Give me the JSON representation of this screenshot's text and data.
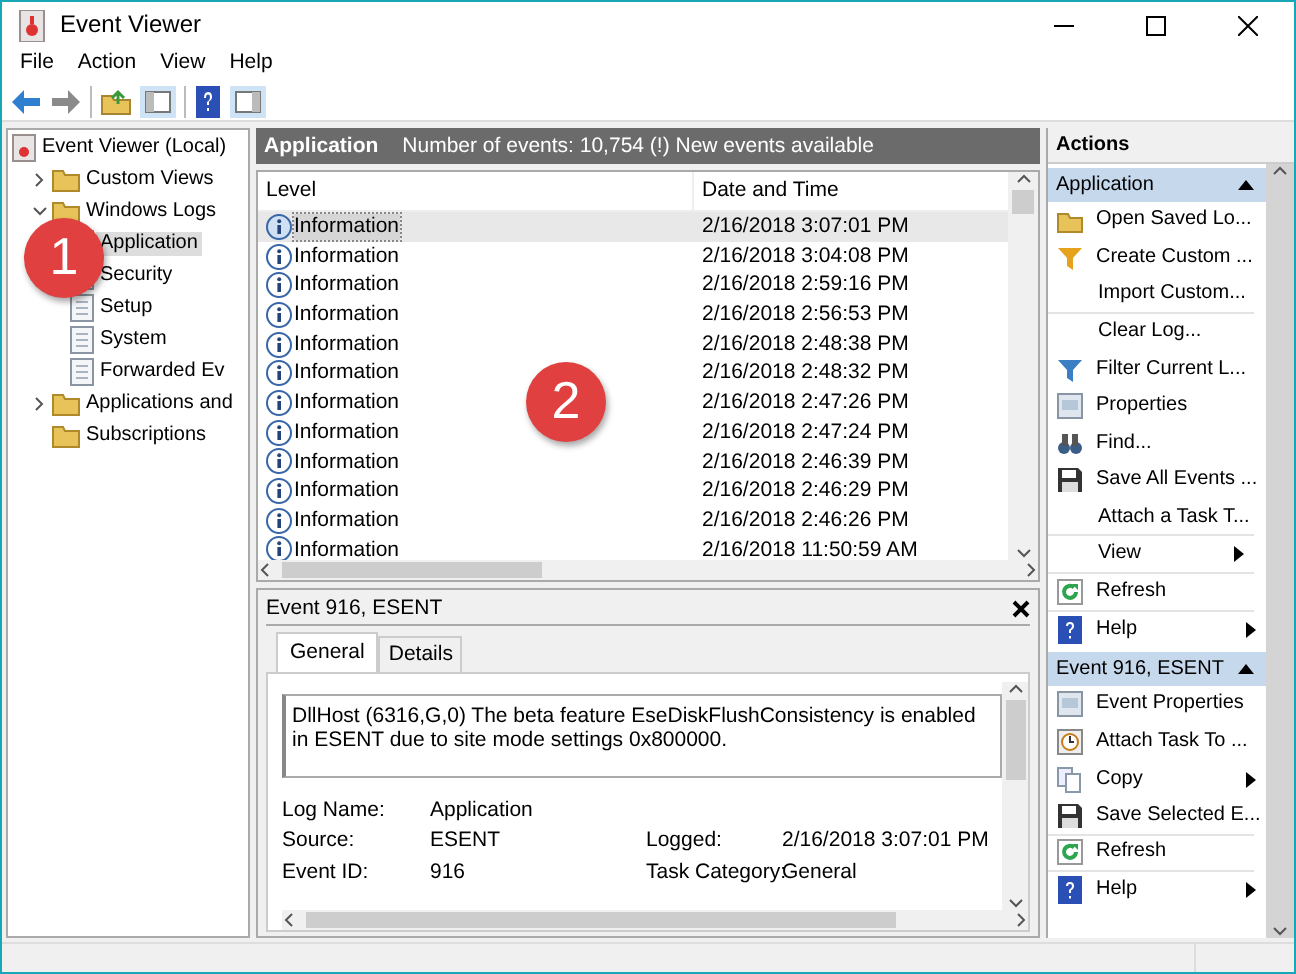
{
  "window": {
    "title": "Event Viewer"
  },
  "menu": [
    "File",
    "Action",
    "View",
    "Help"
  ],
  "tree": {
    "label": "Event Viewer (Local)",
    "selected": false,
    "children": [
      {
        "label": "Custom Views",
        "selected": false,
        "expanded": false
      },
      {
        "label": "Windows Logs",
        "selected": false,
        "expanded": true,
        "children": [
          {
            "label": "Application",
            "selected": true
          },
          {
            "label": "Security",
            "selected": false
          },
          {
            "label": "Setup",
            "selected": false
          },
          {
            "label": "System",
            "selected": false
          },
          {
            "label": "Forwarded Ev",
            "selected": false
          }
        ]
      },
      {
        "label": "Applications and",
        "selected": false,
        "expanded": false
      },
      {
        "label": "Subscriptions",
        "selected": false
      }
    ]
  },
  "events": {
    "title": "Application",
    "summary": "Number of events: 10,754 (!) New events available",
    "columns": [
      "Level",
      "Date and Time"
    ],
    "rows": [
      {
        "level": "Information",
        "date_time": "2/16/2018 3:07:01 PM",
        "selected": true
      },
      {
        "level": "Information",
        "date_time": "2/16/2018 3:04:08 PM",
        "selected": false
      },
      {
        "level": "Information",
        "date_time": "2/16/2018 2:59:16 PM",
        "selected": false
      },
      {
        "level": "Information",
        "date_time": "2/16/2018 2:56:53 PM",
        "selected": false
      },
      {
        "level": "Information",
        "date_time": "2/16/2018 2:48:38 PM",
        "selected": false
      },
      {
        "level": "Information",
        "date_time": "2/16/2018 2:48:32 PM",
        "selected": false
      },
      {
        "level": "Information",
        "date_time": "2/16/2018 2:47:26 PM",
        "selected": false
      },
      {
        "level": "Information",
        "date_time": "2/16/2018 2:47:24 PM",
        "selected": false
      },
      {
        "level": "Information",
        "date_time": "2/16/2018 2:46:39 PM",
        "selected": false
      },
      {
        "level": "Information",
        "date_time": "2/16/2018 2:46:29 PM",
        "selected": false
      },
      {
        "level": "Information",
        "date_time": "2/16/2018 2:46:26 PM",
        "selected": false
      },
      {
        "level": "Information",
        "date_time": "2/16/2018 11:50:59 AM",
        "selected": false
      }
    ]
  },
  "detail": {
    "title": "Event 916, ESENT",
    "tabs": [
      {
        "label": "General",
        "selected": true
      },
      {
        "label": "Details",
        "selected": false
      }
    ],
    "message": "DllHost (6316,G,0) The beta feature EseDiskFlushConsistency is enabled in ESENT due to site mode settings 0x800000.",
    "fields": [
      [
        {
          "label": "Log Name:",
          "value": "Application"
        }
      ],
      [
        {
          "label": "Source:",
          "value": "ESENT"
        },
        {
          "label": "Logged:",
          "value": "2/16/2018 3:07:01 PM"
        }
      ],
      [
        {
          "label": "Event ID:",
          "value": "916"
        },
        {
          "label": "Task Category:",
          "value": "General"
        }
      ]
    ]
  },
  "actions": {
    "title": "Actions",
    "sections": [
      {
        "title": "Application",
        "expanded": true,
        "items": [
          {
            "label": "Open Saved Lo...",
            "submenu": false,
            "separator_after": false
          },
          {
            "label": "Create Custom ...",
            "submenu": false,
            "separator_after": false
          },
          {
            "label": "Import Custom...",
            "submenu": false,
            "separator_after": true
          },
          {
            "label": "Clear Log...",
            "submenu": false,
            "separator_after": false
          },
          {
            "label": "Filter Current L...",
            "submenu": false,
            "separator_after": false
          },
          {
            "label": "Properties",
            "submenu": false,
            "separator_after": false
          },
          {
            "label": "Find...",
            "submenu": false,
            "separator_after": false
          },
          {
            "label": "Save All Events ...",
            "submenu": false,
            "separator_after": false
          },
          {
            "label": "Attach a Task T...",
            "submenu": false,
            "separator_after": true
          },
          {
            "label": "View",
            "submenu": true,
            "separator_after": true
          },
          {
            "label": "Refresh",
            "submenu": false,
            "separator_after": true
          },
          {
            "label": "Help",
            "submenu": true,
            "separator_after": false
          }
        ]
      },
      {
        "title": "Event 916, ESENT",
        "expanded": true,
        "items": [
          {
            "label": "Event Properties",
            "submenu": false,
            "separator_after": false
          },
          {
            "label": "Attach Task To ...",
            "submenu": false,
            "separator_after": false
          },
          {
            "label": "Copy",
            "submenu": true,
            "separator_after": false
          },
          {
            "label": "Save Selected E...",
            "submenu": false,
            "separator_after": true
          },
          {
            "label": "Refresh",
            "submenu": false,
            "separator_after": true
          },
          {
            "label": "Help",
            "submenu": true,
            "separator_after": false
          }
        ]
      }
    ]
  },
  "callouts": [
    {
      "label": "1"
    },
    {
      "label": "2"
    }
  ]
}
